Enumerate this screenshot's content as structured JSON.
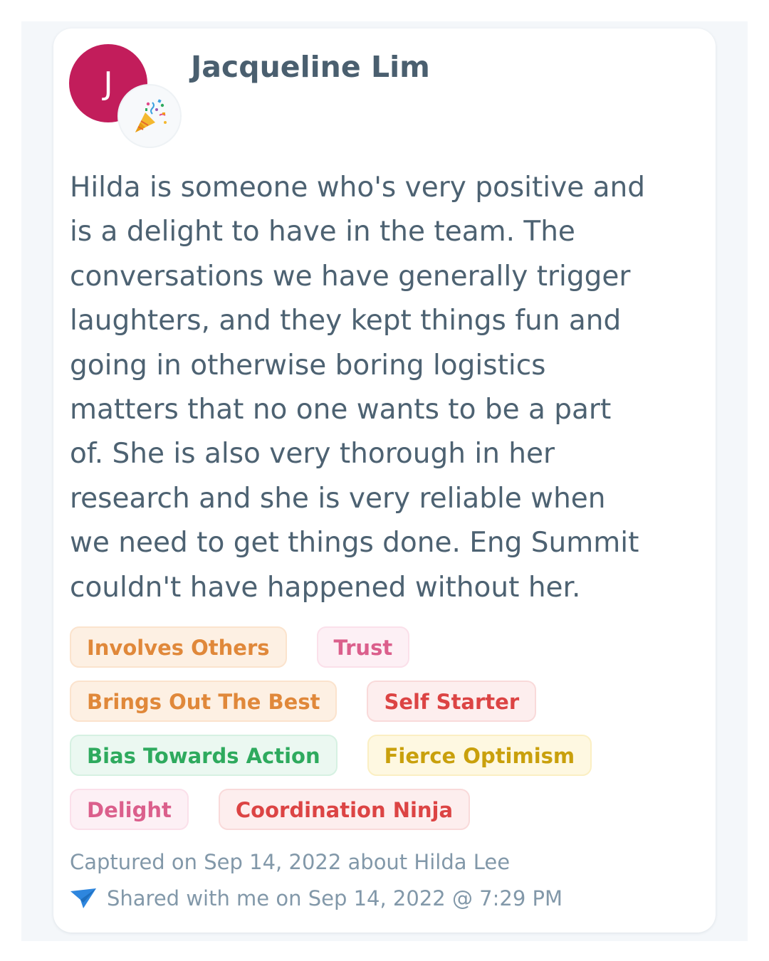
{
  "feedback": {
    "author_name": "Jacqueline Lim",
    "avatar_initial": "J",
    "avatar_color": "#c21d5b",
    "badge_icon": "party-popper-icon",
    "message_lines": [
      "Hilda is someone who's very positive and",
      "is a delight to have in the team. The",
      "conversations we have generally trigger",
      "laughters, and they kept things fun and",
      "going in otherwise boring logistics",
      "matters that no one wants to be a part",
      "of. She is also very thorough in her",
      "research and she is very reliable when",
      "we need to get things done. Eng Summit",
      "couldn't have happened without her."
    ],
    "tags": [
      {
        "label": "Involves Others",
        "color": "orange"
      },
      {
        "label": "Trust",
        "color": "pink"
      },
      {
        "label": "Brings Out The Best",
        "color": "orange"
      },
      {
        "label": "Self Starter",
        "color": "red"
      },
      {
        "label": "Bias Towards Action",
        "color": "green"
      },
      {
        "label": "Fierce Optimism",
        "color": "yellow"
      },
      {
        "label": "Delight",
        "color": "pink"
      },
      {
        "label": "Coordination Ninja",
        "color": "red"
      }
    ],
    "captured_text": "Captured on Sep 14, 2022 about Hilda Lee",
    "shared_icon": "paper-plane-icon",
    "shared_text": "Shared with me on Sep 14, 2022 @ 7:29 PM"
  },
  "colors": {
    "text_primary": "#4d6272",
    "text_muted": "#8298a9",
    "share_icon": "#2e86de"
  }
}
